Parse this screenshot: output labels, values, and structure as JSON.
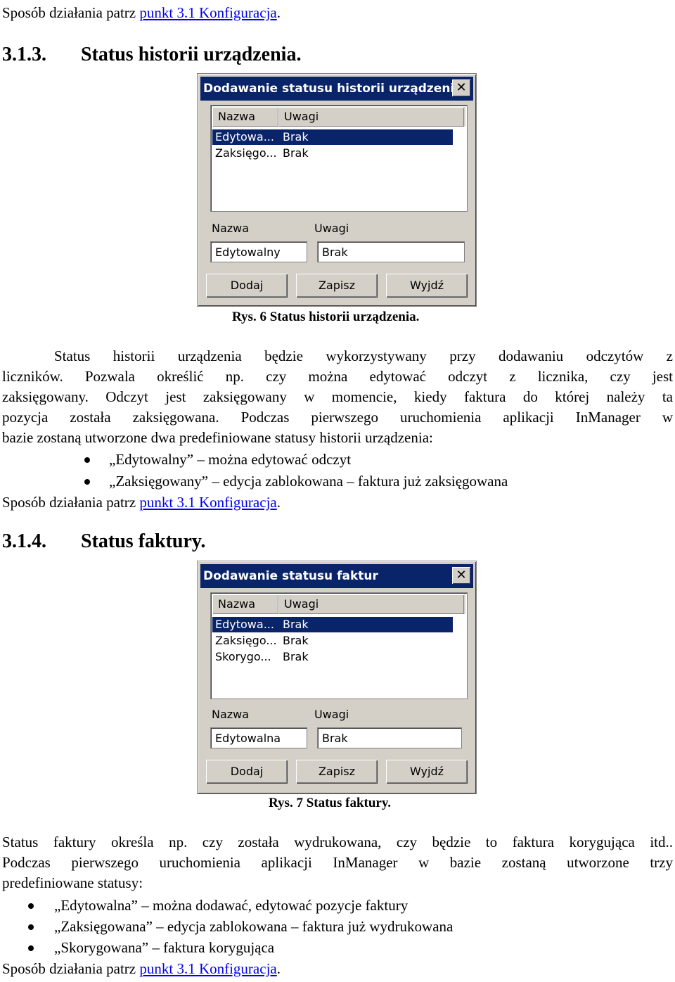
{
  "top_line": {
    "text": "Sposób działania patrz ",
    "link": "punkt 3.1 Konfiguracja",
    "end": "."
  },
  "section1": {
    "number": "3.1.3.",
    "title": "Status historii urządzenia."
  },
  "dialog1": {
    "title": "Dodawanie statusu historii urządzenia",
    "close": "✕",
    "columns": [
      "Nazwa",
      "Uwagi"
    ],
    "rows": [
      {
        "name": "Edytowa...",
        "note": "Brak",
        "selected": true
      },
      {
        "name": "Zaksięgo...",
        "note": "Brak",
        "selected": false
      }
    ],
    "name_label": "Nazwa",
    "note_label": "Uwagi",
    "name_value": "Edytowalny",
    "note_value": "Brak",
    "buttons": [
      "Dodaj",
      "Zapisz",
      "Wyjdź"
    ]
  },
  "caption1": "Rys. 6 Status historii  urządzenia.",
  "para1": [
    "Status historii urządzenia będzie wykorzystywany przy dodawaniu odczytów z",
    "liczników. Pozwala określić np. czy można edytować odczyt z licznika, czy jest",
    "zaksięgowany. Odczyt jest zaksięgowany w momencie, kiedy faktura do której należy ta",
    "pozycja została zaksięgowana. Podczas pierwszego uruchomienia aplikacji InManager w",
    "bazie zostaną utworzone dwa predefiniowane statusy historii urządzenia:"
  ],
  "bullets1": [
    "„Edytowalny” – można edytować odczyt",
    "„Zaksięgowany” – edycja zablokowana – faktura już zaksięgowana"
  ],
  "ref1": {
    "text": "Sposób działania patrz ",
    "link": "punkt 3.1 Konfiguracja",
    "end": "."
  },
  "section2": {
    "number": "3.1.4.",
    "title": "Status faktury."
  },
  "dialog2": {
    "title": "Dodawanie statusu faktur",
    "close": "✕",
    "columns": [
      "Nazwa",
      "Uwagi"
    ],
    "rows": [
      {
        "name": "Edytowa...",
        "note": "Brak",
        "selected": true
      },
      {
        "name": "Zaksięgo...",
        "note": "Brak",
        "selected": false
      },
      {
        "name": "Skorygo...",
        "note": "Brak",
        "selected": false
      }
    ],
    "name_label": "Nazwa",
    "note_label": "Uwagi",
    "name_value": "Edytowalna",
    "note_value": "Brak",
    "buttons": [
      "Dodaj",
      "Zapisz",
      "Wyjdź"
    ]
  },
  "caption2": "Rys. 7 Status faktury.",
  "para2": [
    "Status faktury określa np. czy została wydrukowana, czy będzie to faktura korygująca itd..",
    "Podczas pierwszego uruchomienia aplikacji InManager w bazie zostaną utworzone trzy",
    "predefiniowane statusy:"
  ],
  "bullets2": [
    "„Edytowalna” – można dodawać, edytować pozycje faktury",
    "„Zaksięgowana” – edycja zablokowana – faktura już wydrukowana",
    "„Skorygowana” – faktura korygująca"
  ],
  "ref2": {
    "text": "Sposób działania patrz ",
    "link": "punkt 3.1 Konfiguracja",
    "end": "."
  }
}
